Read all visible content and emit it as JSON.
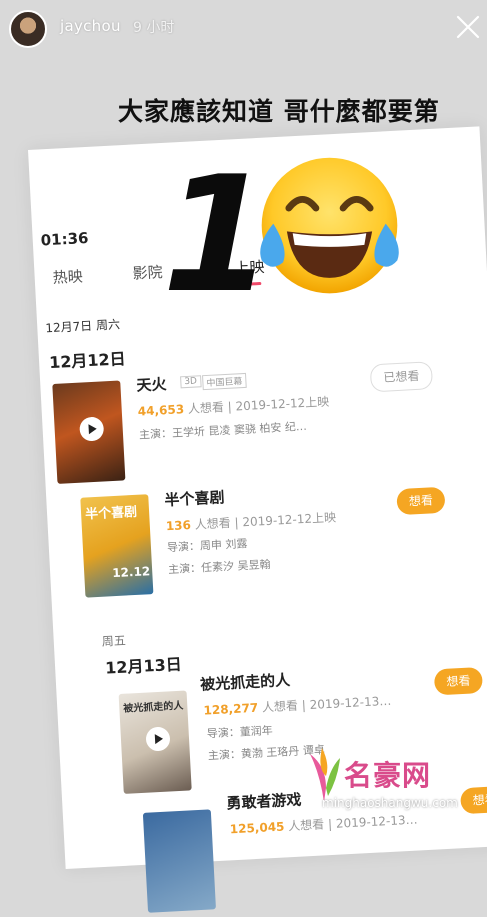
{
  "story": {
    "username": "jaychou",
    "time_ago": "9 小时",
    "caption": "大家應該知道 哥什麼都要第"
  },
  "overlay": {
    "big_number": "1"
  },
  "phone": {
    "time": "01:36",
    "tabs": [
      "热映",
      "影院",
      "上映"
    ],
    "today": "12月7日 周六",
    "sections": [
      {
        "date": "12月12日",
        "films": [
          {
            "title": "天火",
            "badges": [
              "3D",
              "中国巨幕"
            ],
            "fans": "44,653",
            "fans_suffix": "人想看",
            "release": "2019-12-12上映",
            "line2": "主演：王学圻 昆凌 窦骁 柏安 纪…",
            "button": "已想看"
          },
          {
            "title": "半个喜剧",
            "poster_title": "半个喜剧",
            "poster_date": "12.12",
            "fans": "136",
            "fans_suffix": "人想看",
            "release": "2019-12-12上映",
            "line2": "导演：周申 刘露",
            "line3": "主演：任素汐 吴昱翰",
            "button": "想看"
          }
        ]
      },
      {
        "day": "周五",
        "date": "12月13日",
        "films": [
          {
            "title": "被光抓走的人",
            "poster_title": "被光抓走的人",
            "fans": "128,277",
            "fans_suffix": "人想看",
            "release": "2019-12-13…",
            "line2": "导演：董润年",
            "line3": "主演：黄渤 王珞丹 谭卓",
            "button": "想看"
          },
          {
            "title": "勇敢者游戏",
            "fans": "125,045",
            "fans_suffix": "人想看",
            "release": "2019-12-13…",
            "button": "想看"
          }
        ]
      }
    ]
  },
  "watermark": {
    "name": "名豪网",
    "url": "minghaoshangwu.com"
  },
  "colors": {
    "accent_pink": "#f04a6a",
    "want_button": "#f5a623",
    "fans_orange": "#f1a02a"
  }
}
